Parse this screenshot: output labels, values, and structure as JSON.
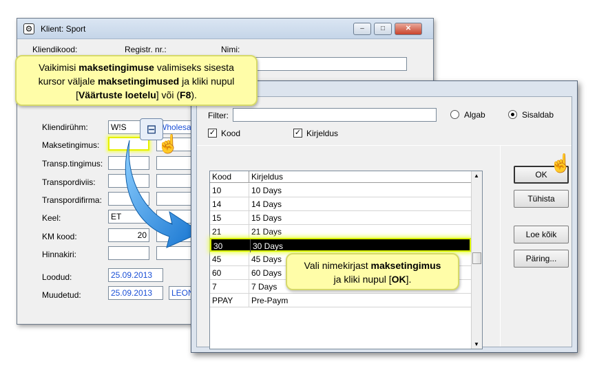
{
  "back_window": {
    "title": "Klient: Sport",
    "app_icon": "gear-icon",
    "controls": {
      "minimize": "–",
      "maximize": "□",
      "close": "✕"
    },
    "header_labels": {
      "kood": "Kliendikood:",
      "regnr": "Registr. nr.:",
      "nimi": "Nimi:"
    },
    "fields": {
      "kliendigrupp_label": "Kliendirühm:",
      "kliendigrupp_value": "W!S",
      "kliendigrupp_desc": "Wholesa",
      "maksetingimus_label": "Maksetingimus:",
      "transp_tingimus_label": "Transp.tingimus:",
      "transpordiviis_label": "Transpordiviis:",
      "transpordifirma_label": "Transpordifirma:",
      "keel_label": "Keel:",
      "keel_value": "ET",
      "km_kood_label": "KM kood:",
      "km_kood_value": "20",
      "hinnakiri_label": "Hinnakiri:",
      "loodud_label": "Loodud:",
      "loodud_value": "25.09.2013",
      "muudetud_label": "Muudetud:",
      "muudetud_value": "25.09.2013",
      "muudetud_user": "LEON"
    }
  },
  "front_window": {
    "filter_label": "Filter:",
    "filter_value": "",
    "radio_algab": "Algab",
    "radio_sisaldab": "Sisaldab",
    "selected_radio": "Sisaldab",
    "check_kood": "Kood",
    "check_kirjeldus": "Kirjeldus",
    "check_mark": "✓",
    "columns": [
      "Kood",
      "Kirjeldus"
    ],
    "rows": [
      {
        "kood": "10",
        "kirjeldus": "10 Days"
      },
      {
        "kood": "14",
        "kirjeldus": "14 Days"
      },
      {
        "kood": "15",
        "kirjeldus": "15 Days"
      },
      {
        "kood": "21",
        "kirjeldus": "21 Days"
      },
      {
        "kood": "30",
        "kirjeldus": "30 Days"
      },
      {
        "kood": "45",
        "kirjeldus": "45 Days"
      },
      {
        "kood": "60",
        "kirjeldus": "60 Days"
      },
      {
        "kood": "7",
        "kirjeldus": "7 Days"
      },
      {
        "kood": "PPAY",
        "kirjeldus": "Pre-Paym"
      }
    ],
    "selected_row": "30",
    "buttons": {
      "ok": "OK",
      "tuhista": "Tühista",
      "loe_koik": "Loe kõik",
      "paring": "Päring..."
    },
    "scroll_up": "▲",
    "scroll_down": "▼"
  },
  "callout_top": {
    "line1_pre": "Vaikimisi ",
    "line1_bold": "maksetingimuse",
    "line1_post": " valimiseks sisesta",
    "line2_pre": "kursor väljale ",
    "line2_bold": "maksetingimused",
    "line2_post": " ja kliki nupul",
    "line3_pre": "[",
    "line3_bold1": "Väärtuste loetelu",
    "line3_mid": "] või (",
    "line3_bold2": "F8",
    "line3_post": ")."
  },
  "callout_bottom": {
    "line1_pre": "Vali nimekirjast ",
    "line1_bold": "maksetingimus",
    "line2_pre": "ja kliki nupul [",
    "line2_bold": "OK",
    "line2_post": "]."
  },
  "icons": {
    "lookup": "list-lookup-icon",
    "pointer": "hand-pointer-icon",
    "arrow": "curved-arrow-icon"
  },
  "colors": {
    "highlight": "#e6f000",
    "callout_bg": "#fffda8",
    "arrow": "#1e90e0",
    "link": "#1a4fd6"
  }
}
